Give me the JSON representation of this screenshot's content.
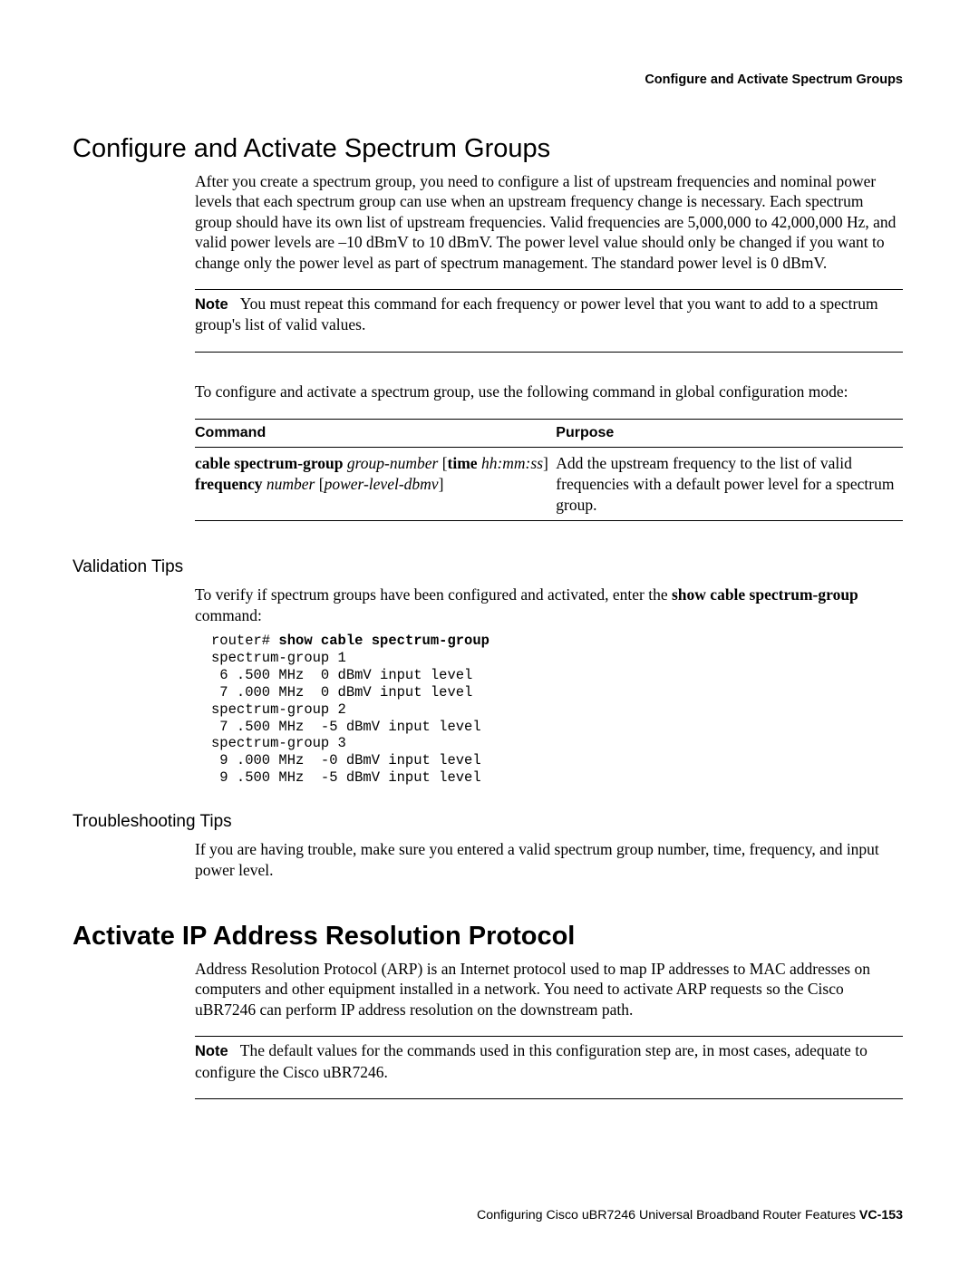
{
  "header": {
    "running_title": "Configure and Activate Spectrum Groups"
  },
  "section1": {
    "title": "Configure and Activate Spectrum Groups",
    "p1": "After you create a spectrum group, you need to configure a list of upstream frequencies and nominal power levels that each spectrum group can use when an upstream frequency change is necessary. Each spectrum group should have its own list of upstream frequencies. Valid frequencies are 5,000,000 to 42,000,000 Hz, and valid power levels are –10 dBmV to 10 dBmV. The power level value should only be changed if you want to change only the power level as part of spectrum management. The standard power level is 0 dBmV.",
    "note1_label": "Note",
    "note1": "You must repeat this command for each frequency or power level that you want to add to a spectrum group's list of valid values.",
    "p2": "To configure and activate a spectrum group, use the following command in global configuration mode:",
    "table": {
      "hdr_command": "Command",
      "hdr_purpose": "Purpose",
      "cmd": {
        "t1": "cable spectrum-group ",
        "t2": "group-number ",
        "t3": "[",
        "t4": "time ",
        "t5": "hh:mm:ss",
        "t6": "] ",
        "t7": "frequency ",
        "t8": "number ",
        "t9": "[",
        "t10": "power-level-dbmv",
        "t11": "]"
      },
      "purpose": "Add the upstream frequency to the list of valid frequencies with a default power level for a spectrum group."
    }
  },
  "validation": {
    "title": "Validation Tips",
    "p1a": "To verify if spectrum groups have been configured and activated, enter the ",
    "p1b": "show cable spectrum-group",
    "p1c": " command:",
    "code_prompt": "router# ",
    "code_cmd": "show cable spectrum-group",
    "code_lines": [
      "spectrum-group 1",
      " 6 .500 MHz  0 dBmV input level",
      " 7 .000 MHz  0 dBmV input level",
      "spectrum-group 2",
      " 7 .500 MHz  -5 dBmV input level",
      "spectrum-group 3",
      " 9 .000 MHz  -0 dBmV input level",
      " 9 .500 MHz  -5 dBmV input level"
    ]
  },
  "troubleshooting": {
    "title": "Troubleshooting Tips",
    "p1": "If you are having trouble, make sure you entered a valid spectrum group number, time, frequency, and input power level."
  },
  "section2": {
    "title": "Activate IP Address Resolution Protocol",
    "p1": "Address Resolution Protocol (ARP) is an Internet protocol used to map IP addresses to MAC addresses on computers and other equipment installed in a network. You need to activate ARP requests so the Cisco uBR7246 can perform IP address resolution on the downstream path.",
    "note_label": "Note",
    "note": "The default values for the commands used in this configuration step are, in most cases, adequate to configure the Cisco uBR7246."
  },
  "footer": {
    "text": "Configuring Cisco uBR7246 Universal Broadband Router Features  ",
    "page": "VC-153"
  }
}
